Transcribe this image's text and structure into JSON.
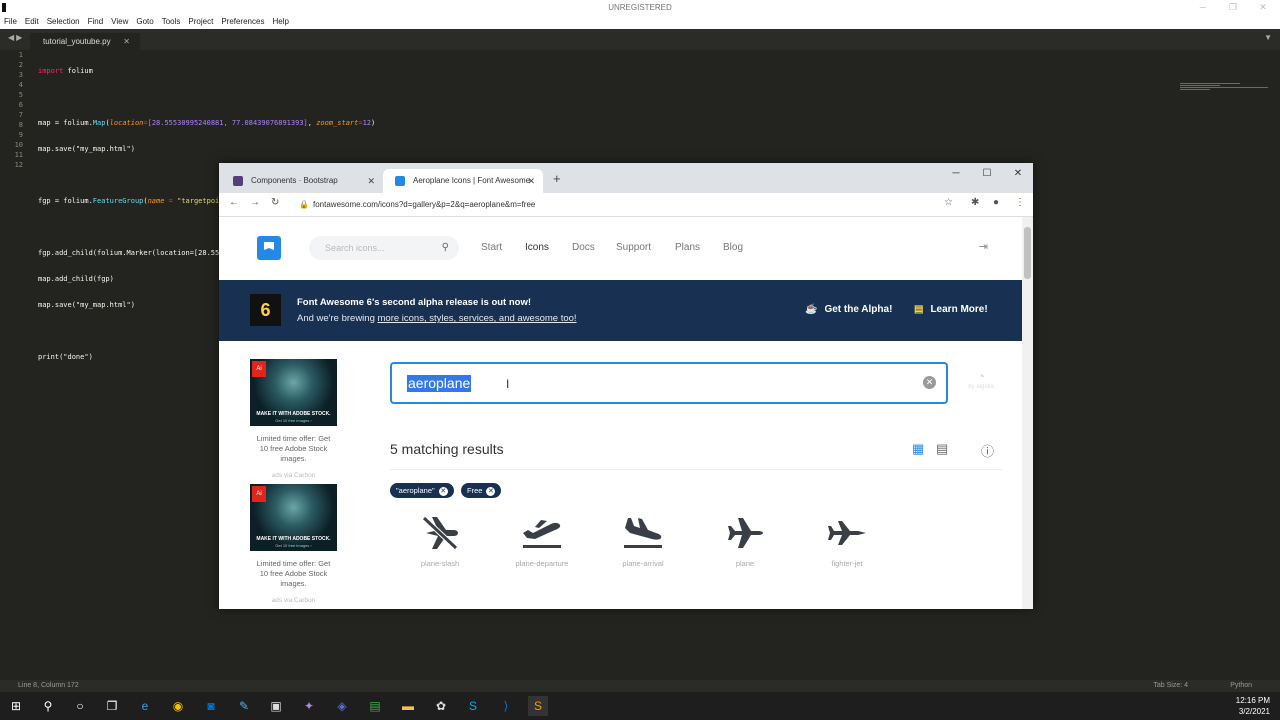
{
  "sublime": {
    "title": "UNREGISTERED",
    "menu": [
      "File",
      "Edit",
      "Selection",
      "Find",
      "View",
      "Goto",
      "Tools",
      "Project",
      "Preferences",
      "Help"
    ],
    "tab": "tutorial_youtube.py",
    "line_numbers": [
      "1",
      "2",
      "3",
      "4",
      "5",
      "6",
      "7",
      "8",
      "9",
      "10",
      "11",
      "12"
    ],
    "status_left": "Line 8, Column 172",
    "status_tab": "Tab Size: 4",
    "status_lang": "Python"
  },
  "code": {
    "l1_kw": "import",
    "l1_rest": " folium",
    "l3_a": "map = folium.",
    "l3_fn": "Map",
    "l3_arg1": "location",
    "l3_num": "[28.55530995240881, 77.08439076891393]",
    "l3_arg2": "zoom_start",
    "l3_num2": "12",
    "l4": "map.save(\"my_map.html\")",
    "l6_a": "fgp = folium.",
    "l6_fn": "FeatureGroup",
    "l6_arg": "name",
    "l6_str": "\"targetpoint\"",
    "l8": "fgp.add_child(folium.Marker(location=[28.55530995240881, 77.08439076891393], popup=folium.Popup(\"Delhi Airport\"), icon=folium.Icon(color=\"green\", icon=\"glyphicon-plane\")))",
    "l9": "map.add_child(fgp)",
    "l10": "map.save(\"my_map.html\")",
    "l12": "print(\"done\")"
  },
  "browser": {
    "tabs": [
      {
        "label": "Components · Bootstrap",
        "favicon_color": "#563d7c"
      },
      {
        "label": "Aeroplane Icons | Font Awesome",
        "favicon_color": "#228ae6"
      }
    ],
    "url": "fontawesome.com/icons?d=gallery&p=2&q=aeroplane&m=free"
  },
  "fa": {
    "search_placeholder": "Search icons...",
    "nav": [
      "Start",
      "Icons",
      "Docs",
      "Support",
      "Plans",
      "Blog"
    ],
    "banner": {
      "badge": "6",
      "headline": "Font Awesome 6's second alpha release is out now!",
      "sub_pre": "And we're brewing ",
      "sub_link": "more icons, styles, services, and awesome too!",
      "cta1": "Get the Alpha!",
      "cta2": "Learn More!"
    },
    "ad": {
      "img_text": "MAKE IT WITH ADOBE STOCK.",
      "img_sub": "Get 10 free images ›",
      "caption": "Limited time offer: Get 10 free Adobe Stock images.",
      "via": "ads via Carbon"
    },
    "search_value": "aeroplane",
    "algolia": "by algolia",
    "results": "5 matching results",
    "chips": [
      "\"aeroplane\"",
      "Free"
    ],
    "icons": [
      "plane-slash",
      "plane-departure",
      "plane-arrival",
      "plane",
      "fighter-jet"
    ]
  },
  "taskbar": {
    "time": "12:16 PM",
    "date": "3/2/2021"
  },
  "colors": {
    "accent": "#228ae6",
    "banner": "#183153",
    "gold": "#ffd43b"
  }
}
